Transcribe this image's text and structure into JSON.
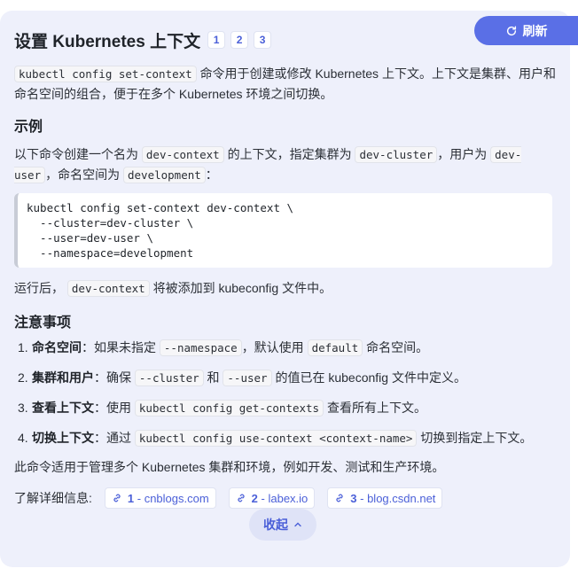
{
  "header": {
    "title": "设置 Kubernetes 上下文",
    "citations": [
      "1",
      "2",
      "3"
    ],
    "refresh_label": "刷新"
  },
  "intro": {
    "code": "kubectl config set-context",
    "text": "命令用于创建或修改 Kubernetes 上下文。上下文是集群、用户和命名空间的组合，便于在多个 Kubernetes 环境之间切换。"
  },
  "example": {
    "heading": "示例",
    "desc_1": "以下命令创建一个名为",
    "code_context": "dev-context",
    "desc_2": "的上下文，指定集群为",
    "code_cluster": "dev-cluster",
    "desc_3": "，用户为",
    "code_user": "dev-user",
    "desc_4": "，命名空间为",
    "code_ns": "development",
    "desc_5": "：",
    "code_block": "kubectl config set-context dev-context \\\n  --cluster=dev-cluster \\\n  --user=dev-user \\\n  --namespace=development",
    "after_1": "运行后，",
    "after_code": "dev-context",
    "after_2": "将被添加到 kubeconfig 文件中。"
  },
  "notes": {
    "heading": "注意事项",
    "items": [
      {
        "num": "1.",
        "title": "命名空间",
        "pre": "：如果未指定",
        "code1": "--namespace",
        "mid": "，默认使用",
        "code2": "default",
        "post": "命名空间。"
      },
      {
        "num": "2.",
        "title": "集群和用户",
        "pre": "：确保",
        "code1": "--cluster",
        "mid": "和",
        "code2": "--user",
        "post": "的值已在 kubeconfig 文件中定义。"
      },
      {
        "num": "3.",
        "title": "查看上下文",
        "pre": "：使用",
        "code1": "kubectl config get-contexts",
        "post": "查看所有上下文。"
      },
      {
        "num": "4.",
        "title": "切换上下文",
        "pre": "：通过",
        "code1": "kubectl config use-context <context-name>",
        "post": "切换到指定上下文。"
      }
    ],
    "summary": "此命令适用于管理多个 Kubernetes 集群和环境，例如开发、测试和生产环境。"
  },
  "sources": {
    "label": "了解详细信息:",
    "items": [
      {
        "num": "1",
        "name": "- cnblogs.com"
      },
      {
        "num": "2",
        "name": "- labex.io"
      },
      {
        "num": "3",
        "name": "- blog.csdn.net"
      }
    ]
  },
  "collapse_label": "收起"
}
